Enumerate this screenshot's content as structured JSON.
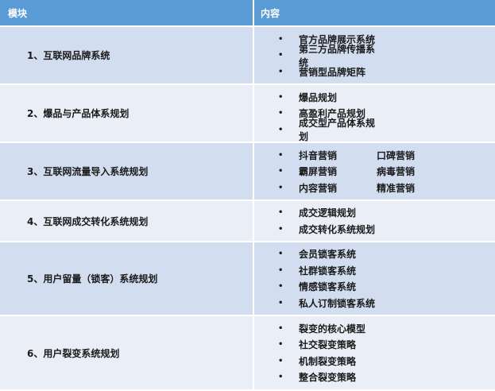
{
  "header": {
    "module": "模块",
    "content": "内容"
  },
  "rows": [
    {
      "module": "1、互联网品牌系统",
      "items": [
        [
          "官方品牌展示系统"
        ],
        [
          "第三方品牌传播系统"
        ],
        [
          "营销型品牌矩阵"
        ]
      ]
    },
    {
      "module": "2、爆品与产品体系规划",
      "items": [
        [
          "爆品规划"
        ],
        [
          "高盈利产品规划"
        ],
        [
          "成交型产品体系规划"
        ]
      ]
    },
    {
      "module": "3、互联网流量导入系统规划",
      "items": [
        [
          "抖音营销",
          "口碑营销"
        ],
        [
          "霸屏营销",
          "病毒营销"
        ],
        [
          "内容营销",
          "精准营销"
        ]
      ]
    },
    {
      "module": "4、互联网成交转化系统规划",
      "items": [
        [
          "成交逻辑规划"
        ],
        [
          "成交转化系统规划"
        ]
      ]
    },
    {
      "module": "5、用户留量（锁客）系统规划",
      "items": [
        [
          "会员锁客系统"
        ],
        [
          "社群锁客系统"
        ],
        [
          "情感锁客系统"
        ],
        [
          "私人订制锁客系统"
        ]
      ]
    },
    {
      "module": "6、用户裂变系统规划",
      "items": [
        [
          "裂变的核心模型"
        ],
        [
          "社交裂变策略"
        ],
        [
          "机制裂变策略"
        ],
        [
          "整合裂变策略"
        ]
      ]
    }
  ],
  "bullet": "•",
  "colors": {
    "header_bg": "#5b9bd5",
    "row_dark": "#d2def0",
    "row_light": "#eaeff7"
  }
}
